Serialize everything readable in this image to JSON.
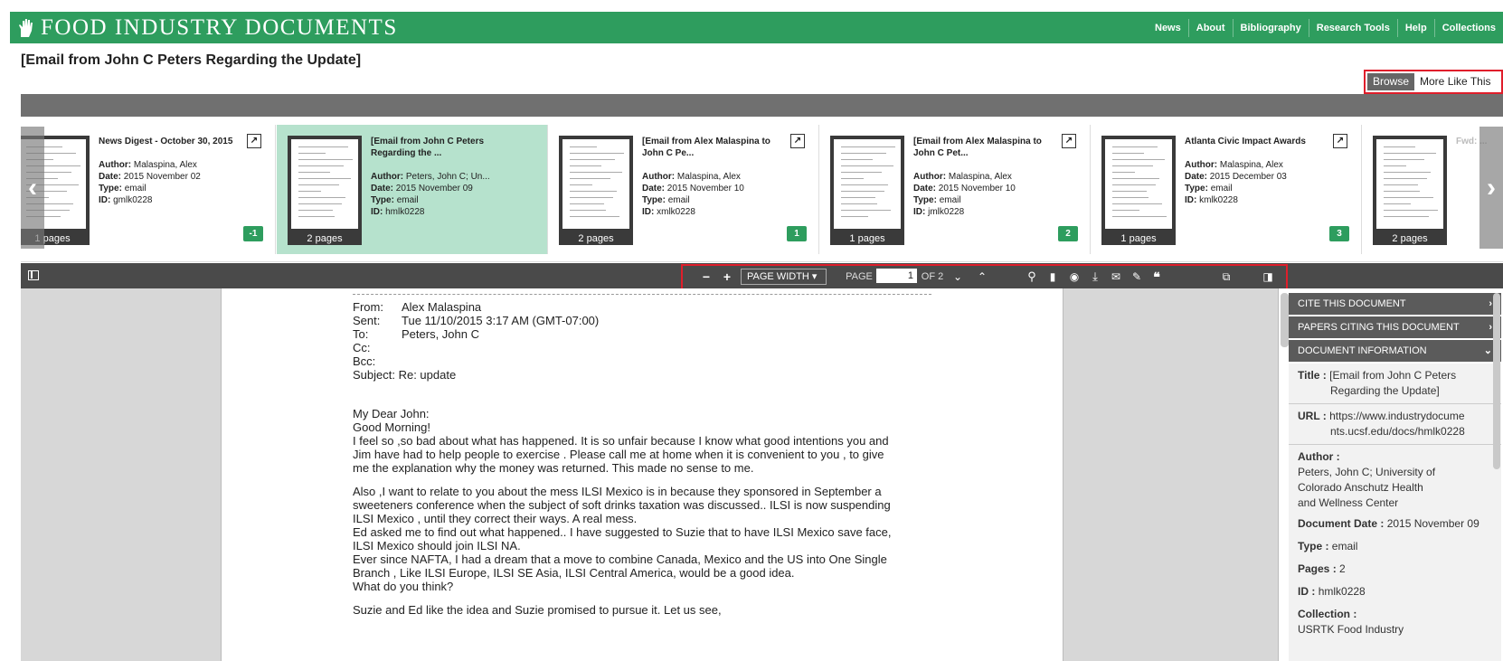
{
  "header": {
    "logo_text": "FOOD INDUSTRY DOCUMENTS",
    "nav": [
      "News",
      "About",
      "Bibliography",
      "Research Tools",
      "Help",
      "Collections"
    ]
  },
  "document_title": "[Email from John C Peters Regarding the Update]",
  "view_tabs": {
    "browse": "Browse",
    "more": "More Like This"
  },
  "carousel": [
    {
      "name": "News Digest - October 30, 2015",
      "author": "Malaspina, Alex",
      "date": "2015 November 02",
      "type": "email",
      "id": "gmlk0228",
      "pages": "1 pages",
      "badge": "-1"
    },
    {
      "name": "[Email from John C Peters Regarding the ...",
      "author": "Peters, John C; Un...",
      "date": "2015 November 09",
      "type": "email",
      "id": "hmlk0228",
      "pages": "2 pages",
      "badge": ""
    },
    {
      "name": "[Email from Alex Malaspina to John C Pe...",
      "author": "Malaspina, Alex",
      "date": "2015 November 10",
      "type": "email",
      "id": "xmlk0228",
      "pages": "2 pages",
      "badge": "1"
    },
    {
      "name": "[Email from Alex Malaspina to John C Pet...",
      "author": "Malaspina, Alex",
      "date": "2015 November 10",
      "type": "email",
      "id": "jmlk0228",
      "pages": "1 pages",
      "badge": "2"
    },
    {
      "name": "Atlanta Civic Impact Awards",
      "author": "Malaspina, Alex",
      "date": "2015 December 03",
      "type": "email",
      "id": "kmlk0228",
      "pages": "1 pages",
      "badge": "3"
    },
    {
      "name": "Fwd: ...",
      "author": "",
      "date": "",
      "type": "",
      "id": "",
      "pages": "2 pages",
      "badge": ""
    }
  ],
  "field_labels": {
    "author": "Author:",
    "date": "Date:",
    "type": "Type:",
    "id": "ID:"
  },
  "toolbar": {
    "zoom_out": "−",
    "zoom_in": "+",
    "zoom_mode": "PAGE WIDTH ▾",
    "page_label": "PAGE",
    "page_value": "1",
    "page_total": "OF 2"
  },
  "email": {
    "headers": [
      {
        "k": "From:",
        "v": "Alex Malaspina"
      },
      {
        "k": "Sent:",
        "v": "Tue 11/10/2015 3:17 AM (GMT-07:00)"
      },
      {
        "k": "To:",
        "v": "Peters, John C"
      },
      {
        "k": "Cc:",
        "v": ""
      },
      {
        "k": "Bcc:",
        "v": ""
      }
    ],
    "subject": "Subject: Re: update",
    "body": [
      "My Dear John:",
      "Good Morning!",
      " I feel so ,so bad about what has happened. It is so unfair because I know what good intentions you and",
      "Jim have had to help people to exercise . Please call me at home when it is convenient to you , to give",
      "me the explanation why the money was returned. This made no sense to me.",
      "",
      " Also  ,I want to relate to you about the mess ILSI Mexico is in because they sponsored in September a",
      "sweeteners conference when the subject of soft drinks taxation was discussed.. ILSI  is now suspending",
      "ILSI Mexico , until they correct their ways. A real mess.",
      "Ed asked me to  find out what happened.. I have suggested to Suzie that to have ILSI Mexico save face,",
      "ILSI Mexico should join ILSI NA.",
      "Ever since NAFTA, I had a dream that a move to combine Canada, Mexico and the US into One Single",
      "Branch , Like ILSI Europe, ILSI SE Asia, ILSI Central America, would be a good idea.",
      "What do you think?",
      "",
      "Suzie and Ed like the idea and Suzie promised to pursue it. Let us see,"
    ]
  },
  "side_panel": {
    "cite": "CITE THIS DOCUMENT",
    "papers": "PAPERS CITING THIS DOCUMENT",
    "info": "DOCUMENT INFORMATION",
    "title_label": "Title :",
    "title_val1": "[Email from John C Peters",
    "title_val2": "Regarding the Update]",
    "url_label": "URL :",
    "url_val1": "https://www.industrydocume",
    "url_val2": "nts.ucsf.edu/docs/hmlk0228",
    "author_label": "Author :",
    "author_val1": "Peters, John C; University of",
    "author_val2": "Colorado Anschutz Health",
    "author_val3": "and Wellness Center",
    "date_label": "Document Date :",
    "date_val": "2015 November 09",
    "type_label": "Type :",
    "type_val": "email",
    "pages_label": "Pages :",
    "pages_val": "2",
    "id_label": "ID :",
    "id_val": "hmlk0228",
    "collection_label": "Collection :",
    "collection_val": "USRTK Food Industry"
  },
  "colors": {
    "brand_green": "#2e9d5e",
    "highlight_red": "#e01e2b",
    "active_card": "#b6e2cd"
  }
}
